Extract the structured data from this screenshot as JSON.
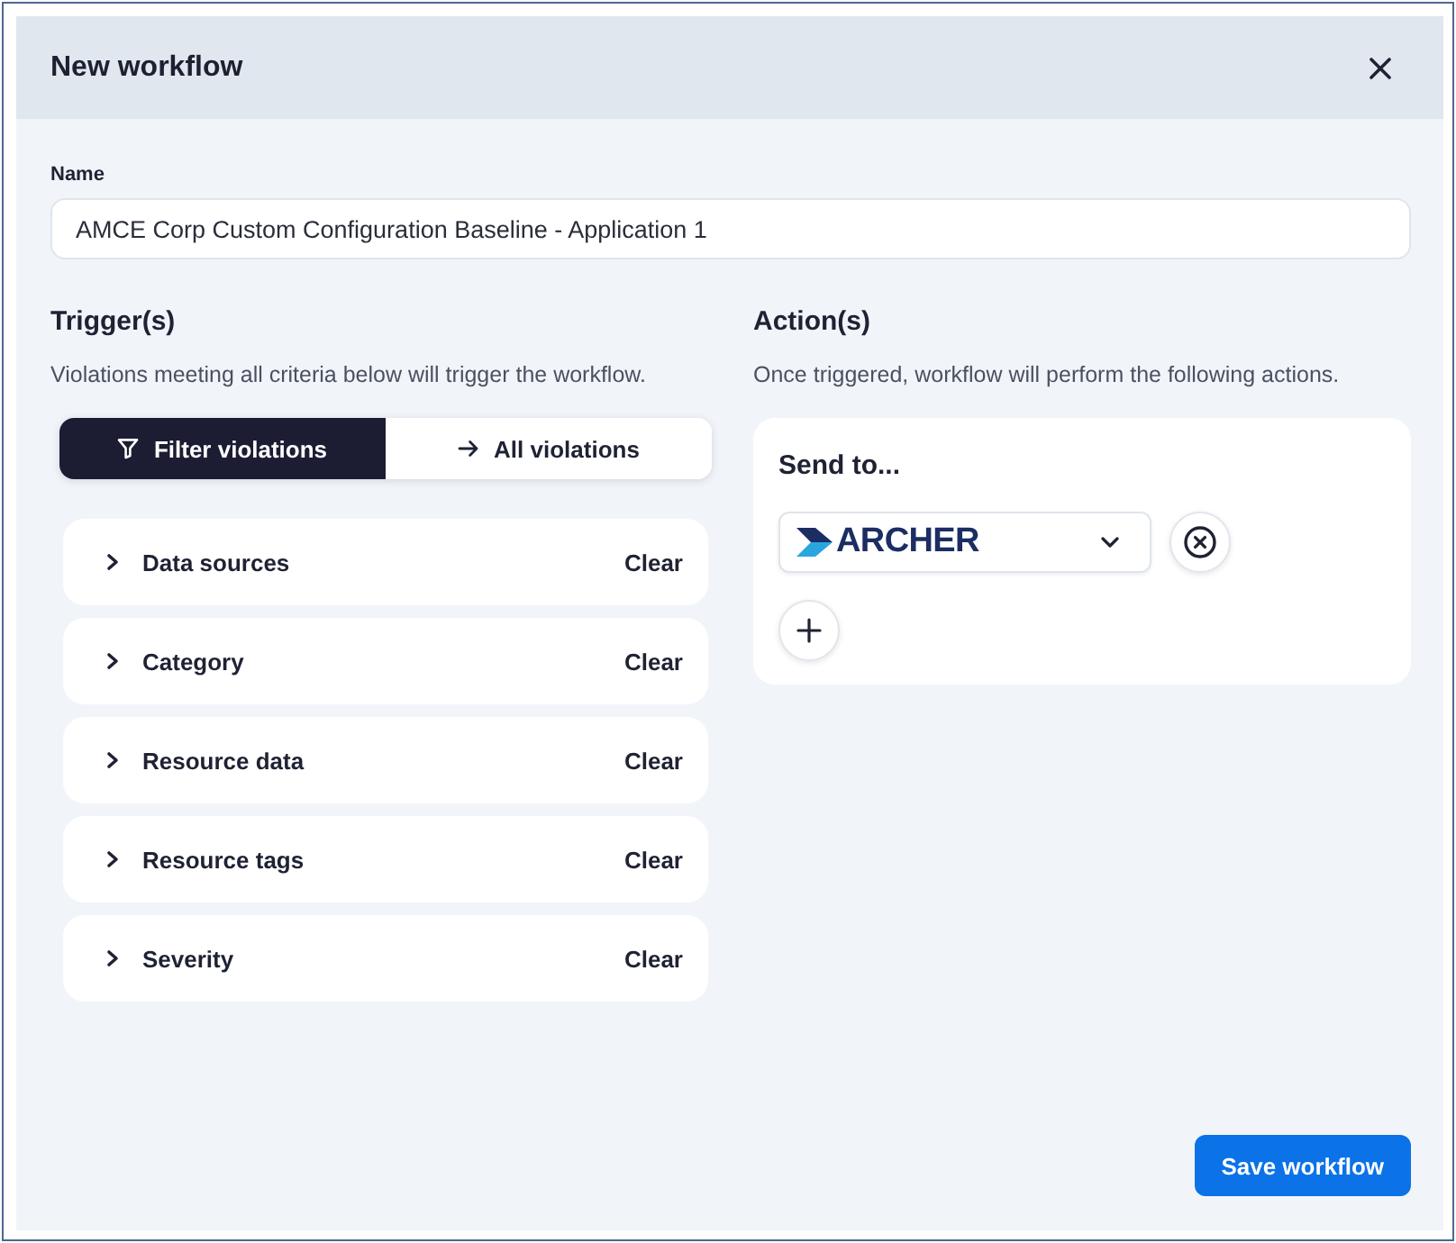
{
  "dialog": {
    "title": "New workflow"
  },
  "name_field": {
    "label": "Name",
    "value": "AMCE Corp Custom Configuration Baseline - Application 1"
  },
  "triggers": {
    "heading": "Trigger(s)",
    "description": "Violations meeting all criteria below will trigger the workflow.",
    "modes": [
      {
        "kind": "filter",
        "label": "Filter violations",
        "selected": true
      },
      {
        "kind": "all",
        "label": "All violations",
        "selected": false
      }
    ],
    "criteria": [
      {
        "label": "Data sources",
        "expanded": false,
        "action": "Clear"
      },
      {
        "label": "Category",
        "expanded": false,
        "action": "Clear"
      },
      {
        "label": "Resource data",
        "expanded": false,
        "action": "Clear"
      },
      {
        "label": "Resource tags",
        "expanded": false,
        "action": "Clear"
      },
      {
        "label": "Severity",
        "expanded": false,
        "action": "Clear"
      }
    ]
  },
  "actions": {
    "heading": "Action(s)",
    "description": "Once triggered, workflow will perform the following actions.",
    "card_title": "Send to...",
    "destinations": [
      {
        "value": "ARCHER"
      }
    ]
  },
  "save_button": {
    "label": "Save workflow"
  }
}
